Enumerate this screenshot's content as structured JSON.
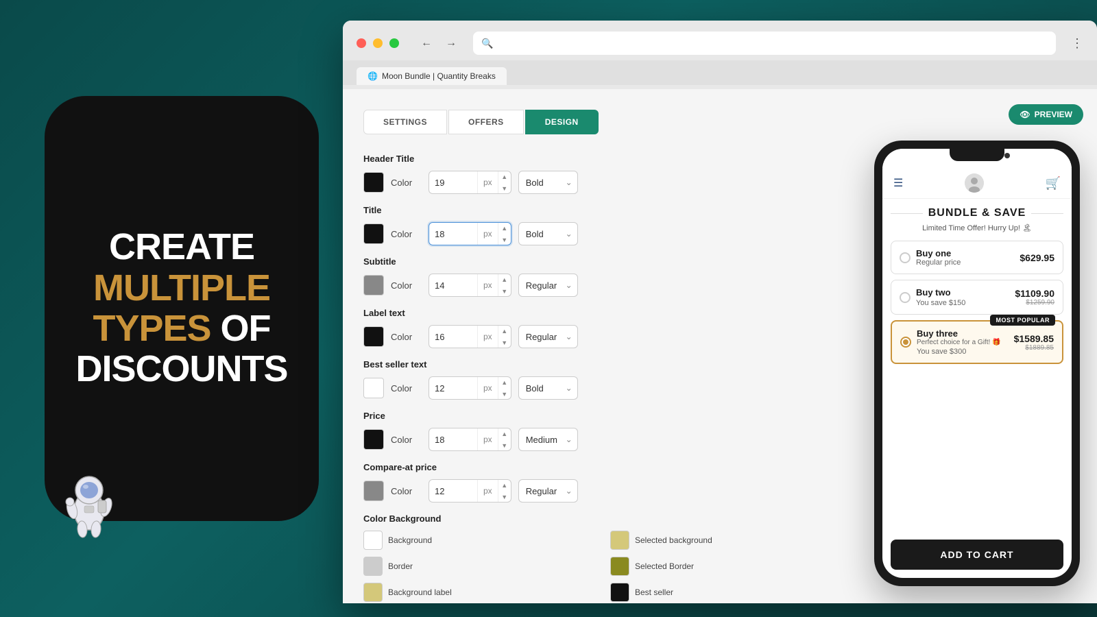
{
  "promo": {
    "line1": "CREATE",
    "line2": "MULTIPLE",
    "line3": "TYPES",
    "line4": "OF",
    "line5": "DISCOUNTS"
  },
  "browser": {
    "tab_title": "Moon Bundle | Quantity Breaks",
    "preview_label": "PREVIEW"
  },
  "tabs": {
    "settings": "SETTINGS",
    "offers": "OFFERS",
    "design": "DESIGN"
  },
  "settings": {
    "header_title_label": "Header Title",
    "header_color_label": "Color",
    "header_size": "19",
    "header_weight": "Bold",
    "title_label": "Title",
    "title_color_label": "Color",
    "title_size": "18",
    "title_weight": "Bold",
    "subtitle_label": "Subtitle",
    "subtitle_color_label": "Color",
    "subtitle_size": "14",
    "subtitle_weight": "Regular",
    "label_text_label": "Label text",
    "label_color_label": "Color",
    "label_size": "16",
    "label_weight": "Regular",
    "best_seller_label": "Best seller text",
    "best_seller_color_label": "Color",
    "best_seller_size": "12",
    "best_seller_weight": "Bold",
    "price_label": "Price",
    "price_color_label": "Color",
    "price_size": "18",
    "price_weight": "Medium",
    "compare_price_label": "Compare-at price",
    "compare_color_label": "Color",
    "compare_size": "12",
    "compare_weight": "Regular",
    "color_bg_label": "Color Background",
    "bg_background_label": "Background",
    "bg_border_label": "Border",
    "bg_label_bg_label": "Background label",
    "bg_selected_bg_label": "Selected background",
    "bg_selected_border_label": "Selected Border",
    "bg_best_seller_label": "Best seller",
    "px_unit": "px"
  },
  "preview": {
    "bundle_title": "BUNDLE & SAVE",
    "bundle_subtitle": "Limited Time Offer! Hurry Up! 🏝",
    "option1_title": "Buy one",
    "option1_subtitle": "Regular price",
    "option1_price": "$629.95",
    "option2_title": "Buy two",
    "option2_save": "You save $150",
    "option2_price": "$1109.90",
    "option2_old_price": "$1259.90",
    "option3_title": "Buy three",
    "option3_subtitle": "Perfect choice for a Gift! 🎁",
    "option3_save": "You save $300",
    "option3_price": "$1589.85",
    "option3_old_price": "$1889.85",
    "most_popular": "MOST POPULAR",
    "add_to_cart": "ADD TO CART"
  },
  "colors": {
    "header_color": "#111111",
    "title_color": "#111111",
    "subtitle_color": "#888888",
    "label_color": "#111111",
    "best_seller_color": "#ffffff",
    "price_color": "#111111",
    "compare_color": "#888888",
    "bg_background": "#ffffff",
    "bg_border": "#cccccc",
    "bg_label_bg": "#d4c87a",
    "bg_selected_bg": "#d4c87a",
    "bg_selected_border": "#8a8a20",
    "bg_best_seller": "#111111"
  }
}
